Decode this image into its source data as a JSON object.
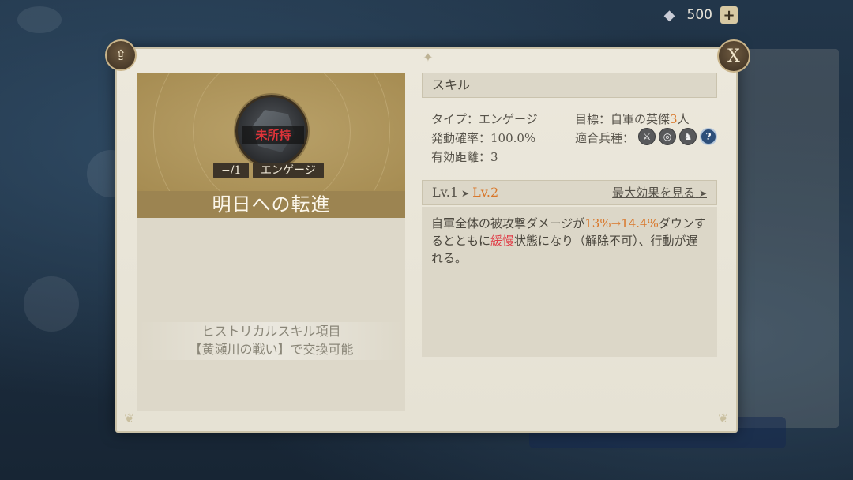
{
  "currency": {
    "amount": "500",
    "plus_label": "+"
  },
  "buttons": {
    "close_label": "X"
  },
  "card": {
    "status": "未所持",
    "count": "−/1",
    "type_tag": "エンゲージ",
    "skill_name": "明日への転進",
    "acquire_line1": "ヒストリカルスキル項目",
    "acquire_line2": "【黄瀬川の戦い】で交換可能"
  },
  "skill": {
    "header": "スキル",
    "type_label": "タイプ：",
    "type_value": "エンゲージ",
    "rate_label": "発動確率：",
    "rate_value": "100.0%",
    "range_label": "有効距離：",
    "range_value": "3",
    "target_label": "目標：",
    "target_value_prefix": "自軍の英傑",
    "target_count": "3",
    "target_value_suffix": "人",
    "unit_label": "適合兵種：",
    "unit_icons": [
      "sword-icon",
      "bow-target-icon",
      "cavalry-icon",
      "help-icon"
    ]
  },
  "level": {
    "current": "Lv.1",
    "arrow": "➤",
    "next": "Lv.2",
    "max_effect": "最大効果を見る",
    "max_arrow": "➤"
  },
  "description": {
    "part1": "自軍全体の被攻撃ダメージが",
    "from_value": "13%",
    "arrow": "→",
    "to_value": "14.4%",
    "part2": "ダウンするとともに",
    "status_word": "緩慢",
    "part3": "状態になり（解除不可）、行動が遅れる。"
  },
  "colors": {
    "accent": "#d9772a",
    "warning": "#e0343a",
    "name_bar": "#9c8451",
    "panel": "#ece8dc"
  }
}
